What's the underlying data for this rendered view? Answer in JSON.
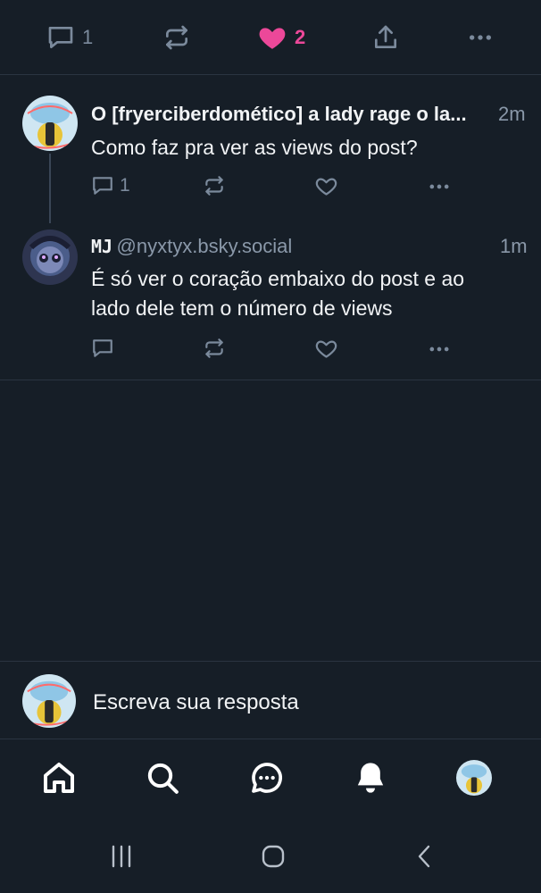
{
  "top_actions": {
    "reply_count": "1",
    "like_count": "2",
    "like_color": "#ec4899"
  },
  "posts": [
    {
      "name": "O [fryerciberdomético] a lady rage o la...",
      "time": "2m",
      "text": "Como faz pra ver as views do post?",
      "reply_count": "1"
    },
    {
      "name": "MJ",
      "handle": "@nyxtyx.bsky.social",
      "time": "1m",
      "text_line1": "É só ver o coração embaixo do post e ao",
      "text_line2": "lado dele tem o número de views"
    }
  ],
  "reply_bar": {
    "placeholder": "Escreva sua resposta"
  },
  "icons": {
    "reply": "reply-icon",
    "repost": "repost-icon",
    "like": "heart-icon",
    "share": "share-icon",
    "more": "more-icon",
    "home": "home-icon",
    "search": "search-icon",
    "chat": "chat-icon",
    "notifications": "bell-icon"
  },
  "colors": {
    "background": "#161e27",
    "divider": "#2a3441",
    "muted": "#7b8a9c",
    "text": "#f1f3f5"
  }
}
